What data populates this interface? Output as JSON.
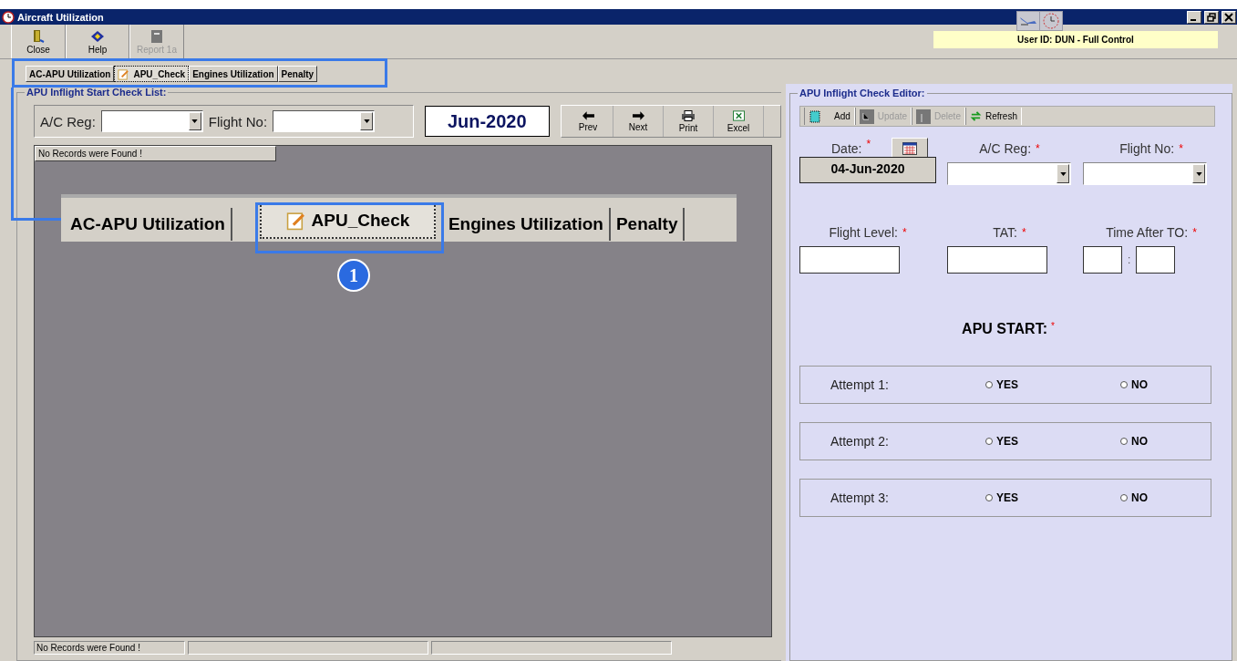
{
  "window": {
    "title": "Aircraft Utilization"
  },
  "toolbar": [
    {
      "label": "Close",
      "kind": "door",
      "disabled": false
    },
    {
      "label": "Help",
      "kind": "book",
      "disabled": false
    },
    {
      "label": "Report 1a",
      "kind": "report",
      "disabled": true
    }
  ],
  "user_info": "User ID: DUN - Full Control",
  "tabs": [
    {
      "label": "AC-APU Utilization",
      "kind": "plain",
      "selected": false
    },
    {
      "label": "APU_Check",
      "kind": "note",
      "selected": true
    },
    {
      "label": "Engines Utilization",
      "kind": "plain",
      "selected": false
    },
    {
      "label": "Penalty",
      "kind": "plain",
      "selected": false
    }
  ],
  "list_panel": {
    "title": "APU Inflight Start Check List:",
    "ac_reg_label": "A/C Reg:",
    "flight_no_label": "Flight No:",
    "month": "Jun-2020",
    "nav_buttons": [
      {
        "label": "Prev",
        "kind": "left"
      },
      {
        "label": "Next",
        "kind": "right"
      },
      {
        "label": "Print",
        "kind": "print"
      },
      {
        "label": "Excel",
        "kind": "excel"
      }
    ],
    "grid_message": "No Records were Found !",
    "status_bar": [
      "No Records were Found !"
    ]
  },
  "callout": {
    "tabs": [
      {
        "label": "AC-APU Utilization",
        "kind": "plain",
        "selected": false
      },
      {
        "label": "APU_Check",
        "kind": "note",
        "selected": true
      },
      {
        "label": "Engines Utilization",
        "kind": "plain",
        "selected": false
      },
      {
        "label": "Penalty",
        "kind": "plain",
        "selected": false
      }
    ],
    "marker": "1"
  },
  "editor": {
    "title": "APU Inflight Check Editor:",
    "toolbar": [
      {
        "label": "Add",
        "kind": "add",
        "disabled": false
      },
      {
        "label": "Update",
        "kind": "update",
        "disabled": true
      },
      {
        "label": "Delete",
        "kind": "delete",
        "disabled": true
      },
      {
        "label": "Refresh",
        "kind": "refresh",
        "disabled": false
      }
    ],
    "date_label": "Date:",
    "date_value": "04-Jun-2020",
    "ac_reg_label": "A/C Reg:",
    "flight_no_label": "Flight No:",
    "flight_level_label": "Flight Level:",
    "tat_label": "TAT:",
    "time_after_label": "Time After TO:",
    "time_separator": ":",
    "required_mark": "*",
    "apu_start_label": "APU START:",
    "attempts": [
      {
        "label": "Attempt 1:",
        "options": [
          {
            "label": "YES",
            "selected": false
          },
          {
            "label": "NO",
            "selected": false
          }
        ]
      },
      {
        "label": "Attempt 2:",
        "options": [
          {
            "label": "YES",
            "selected": false
          },
          {
            "label": "NO",
            "selected": false
          }
        ]
      },
      {
        "label": "Attempt 3:",
        "options": [
          {
            "label": "YES",
            "selected": false
          },
          {
            "label": "NO",
            "selected": false
          }
        ]
      }
    ]
  }
}
